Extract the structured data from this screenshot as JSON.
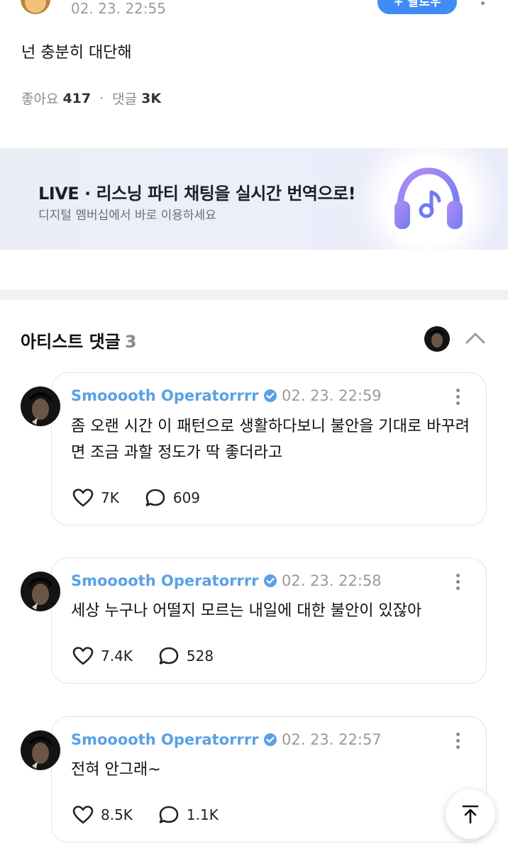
{
  "top_post": {
    "timestamp": "02. 23. 22:55",
    "follow_label": "+ 팔로우",
    "text": "넌 충분히 대단해",
    "likes_label": "좋아요",
    "likes_count": "417",
    "comments_label": "댓글",
    "comments_count": "3K"
  },
  "banner": {
    "title": "LIVE · 리스닝 파티 채팅을 실시간 번역으로!",
    "subtitle": "디지털 멤버십에서 바로 이용하세요",
    "icon": "headphones-music-icon"
  },
  "section": {
    "title": "아티스트 댓글",
    "count": "3"
  },
  "comments": [
    {
      "author": "Smooooth Operatorrrr",
      "timestamp": "02. 23. 22:59",
      "text": "좀 오랜 시간 이 패턴으로 생활하다보니 불안을 기대로 바꾸려면 조금 과할 정도가 딱 좋더라고",
      "likes": "7K",
      "replies": "609"
    },
    {
      "author": "Smooooth Operatorrrr",
      "timestamp": "02. 23. 22:58",
      "text": "세상 누구나 어떨지 모르는 내일에 대한 불안이 있잖아",
      "likes": "7.4K",
      "replies": "528"
    },
    {
      "author": "Smooooth Operatorrrr",
      "timestamp": "02. 23. 22:57",
      "text": "전혀 안그래~",
      "likes": "8.5K",
      "replies": "1.1K"
    }
  ],
  "colors": {
    "accent": "#3f8cf6",
    "author_name": "#5aa1e6",
    "muted": "#9a9a9a"
  }
}
